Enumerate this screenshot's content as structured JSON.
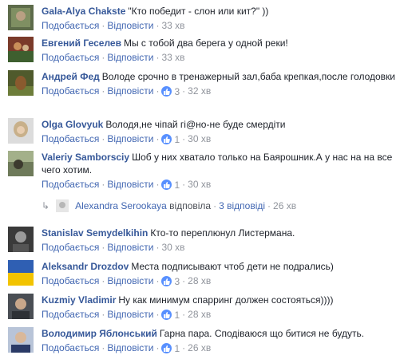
{
  "actions": {
    "like": "Подобається",
    "reply": "Відповісти"
  },
  "comments": [
    {
      "author": "Gala-Alya Chakste",
      "text": "\"Кто победит - слон или кит?\" ))",
      "likes": "",
      "time": "33 хв"
    },
    {
      "author": "Евгений Геселев",
      "text": "Мы с тобой два берега у одной реки!",
      "likes": "",
      "time": "33 хв"
    },
    {
      "author": "Андрей Фед",
      "text": "Володе срочно в тренажерный зал,баба крепкая,после голодовки",
      "likes": "3",
      "time": "32 хв"
    },
    {
      "author": "Olga Glovyuk",
      "text": "Володя,не чіпай гі@но-не буде смердіти",
      "likes": "1",
      "time": "30 хв"
    },
    {
      "author": "Valeriy Samborsciy",
      "text": "Шоб у них хватало только на Баярошник.А у нас на на все чего хотим.",
      "likes": "1",
      "time": "30 хв"
    },
    {
      "author": "Stanislav Semydelkihin",
      "text": "Кто-то переплюнул Листермана.",
      "likes": "",
      "time": "30 хв"
    },
    {
      "author": "Aleksandr Drozdov",
      "text": "Места подписывают чтоб дети не подрались)",
      "likes": "3",
      "time": "28 хв"
    },
    {
      "author": "Kuzmiy Vladimir",
      "text": "Ну как минимум спарринг должен состояться))))",
      "likes": "1",
      "time": "28 хв"
    },
    {
      "author": "Володимир Яблонський",
      "text": "Гарна пара. Сподіваюся що битися не будуть.",
      "likes": "1",
      "time": "26 хв"
    }
  ],
  "reply_summary": {
    "name": "Alexandra Serookaya",
    "action": "відповіла",
    "count": "3 відповіді",
    "time": "26 хв"
  },
  "colors": {
    "link": "#365899",
    "meta": "#90949c",
    "like_badge": "#5890ff"
  }
}
